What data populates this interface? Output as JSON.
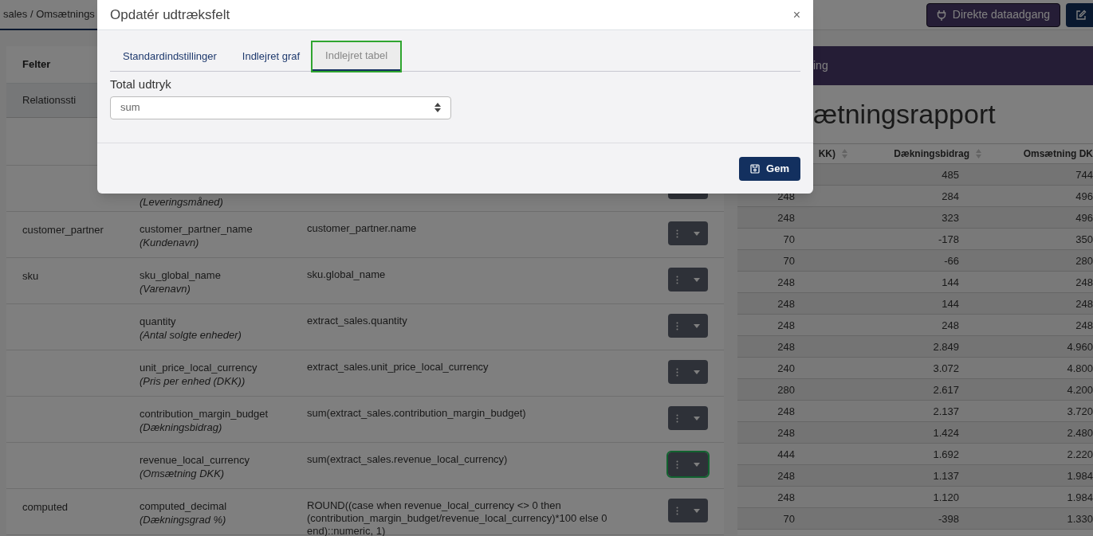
{
  "topbar": {
    "breadcrumb": "sales / Omsætnings",
    "buttons": [
      {
        "kind": "access",
        "label": "Direkte dataadgang"
      },
      {
        "kind": "edit"
      }
    ]
  },
  "fields_table": {
    "header": "Felter",
    "subheader": "Relationssti",
    "rows": [
      {
        "relation": null,
        "name": null,
        "label": "(Leveringsmåned)",
        "expression": null,
        "focused": false
      },
      {
        "relation": "customer_partner",
        "name": "customer_partner_name",
        "label": "(Kundenavn)",
        "expression": "customer_partner.name",
        "focused": false
      },
      {
        "relation": "sku",
        "name": "sku_global_name",
        "label": "(Varenavn)",
        "expression": "sku.global_name",
        "focused": false
      },
      {
        "relation": null,
        "name": "quantity",
        "label": "(Antal solgte enheder)",
        "expression": "extract_sales.quantity",
        "focused": false
      },
      {
        "relation": null,
        "name": "unit_price_local_currency",
        "label": "(Pris per enhed (DKK))",
        "expression": "extract_sales.unit_price_local_currency",
        "focused": false
      },
      {
        "relation": null,
        "name": "contribution_margin_budget",
        "label": "(Dækningsbidrag)",
        "expression": "sum(extract_sales.contribution_margin_budget)",
        "focused": false
      },
      {
        "relation": null,
        "name": "revenue_local_currency",
        "label": "(Omsætning DKK)",
        "expression": "sum(extract_sales.revenue_local_currency)",
        "focused": true
      },
      {
        "relation": "computed",
        "name": "computed_decimal",
        "label": "(Dækningsgrad %)",
        "expression": "ROUND((case when revenue_local_currency <> 0 then (contribution_margin_budget/revenue_local_currency)*100 else 0 end)::numeric, 1)",
        "focused": false
      }
    ]
  },
  "preview": {
    "bar_title": "ing",
    "report_title": "ætningsrapport",
    "columns": [
      {
        "label": "KK)",
        "sortable": true
      },
      {
        "label": "Dækningsbidrag",
        "sortable": true
      },
      {
        "label": "Omsætning DK",
        "sortable": false
      }
    ],
    "rows": [
      {
        "cells": [
          null,
          "485",
          "744"
        ]
      },
      {
        "cells": [
          "248",
          "284",
          "496"
        ]
      },
      {
        "cells": [
          "248",
          "323",
          "496"
        ]
      },
      {
        "cells": [
          "70",
          "-178",
          "350"
        ]
      },
      {
        "cells": [
          "70",
          "-66",
          "280"
        ]
      },
      {
        "cells": [
          "248",
          "144",
          "248"
        ]
      },
      {
        "cells": [
          "248",
          "144",
          "248"
        ]
      },
      {
        "cells": [
          "248",
          "248",
          "248"
        ]
      },
      {
        "cells": [
          "248",
          "2.849",
          "4.960"
        ]
      },
      {
        "cells": [
          "240",
          "3.072",
          "4.800"
        ]
      },
      {
        "cells": [
          "280",
          "2.617",
          "4.200"
        ]
      },
      {
        "cells": [
          "248",
          "2.137",
          "3.720"
        ]
      },
      {
        "cells": [
          "248",
          "1.424",
          "2.480"
        ]
      },
      {
        "cells": [
          "444",
          "1.692",
          "2.220"
        ]
      },
      {
        "cells": [
          "248",
          "1.137",
          "1.984"
        ]
      },
      {
        "cells": [
          "248",
          "1.120",
          "1.984"
        ]
      },
      {
        "cells": [
          "70",
          "-398",
          "1.330"
        ]
      }
    ]
  },
  "dialog": {
    "title": "Opdatér udtræksfelt",
    "close": "×",
    "tabs": [
      {
        "label": "Standardindstillinger",
        "selected": false,
        "focused": false
      },
      {
        "label": "Indlejret graf",
        "selected": false,
        "focused": false
      },
      {
        "label": "Indlejret tabel",
        "selected": true,
        "focused": true
      }
    ],
    "field_label": "Total udtryk",
    "select_value": "sum",
    "save_label": "Gem"
  }
}
